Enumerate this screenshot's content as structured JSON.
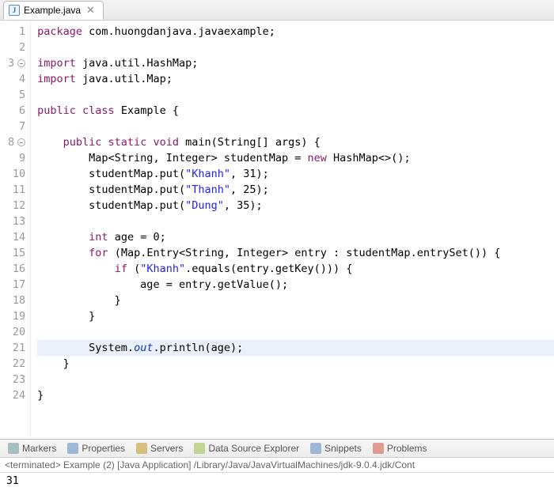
{
  "tab": {
    "filename": "Example.java"
  },
  "code": {
    "lines": [
      {
        "n": 1,
        "tokens": [
          [
            "kw",
            "package"
          ],
          [
            "",
            " com.huongdanjava.javaexample;"
          ]
        ]
      },
      {
        "n": 2,
        "tokens": []
      },
      {
        "n": 3,
        "fold": true,
        "tokens": [
          [
            "kw",
            "import"
          ],
          [
            "",
            " java.util.HashMap;"
          ]
        ]
      },
      {
        "n": 4,
        "tokens": [
          [
            "kw",
            "import"
          ],
          [
            "",
            " java.util.Map;"
          ]
        ]
      },
      {
        "n": 5,
        "tokens": []
      },
      {
        "n": 6,
        "tokens": [
          [
            "kw",
            "public class"
          ],
          [
            "",
            " Example {"
          ]
        ]
      },
      {
        "n": 7,
        "tokens": []
      },
      {
        "n": 8,
        "fold": true,
        "tokens": [
          [
            "",
            "    "
          ],
          [
            "kw",
            "public static void"
          ],
          [
            "",
            " main(String[] args) {"
          ]
        ]
      },
      {
        "n": 9,
        "tokens": [
          [
            "",
            "        Map<String, Integer> studentMap = "
          ],
          [
            "kw",
            "new"
          ],
          [
            "",
            " HashMap<>();"
          ]
        ]
      },
      {
        "n": 10,
        "tokens": [
          [
            "",
            "        studentMap.put("
          ],
          [
            "str",
            "\"Khanh\""
          ],
          [
            "",
            ", 31);"
          ]
        ]
      },
      {
        "n": 11,
        "tokens": [
          [
            "",
            "        studentMap.put("
          ],
          [
            "str",
            "\"Thanh\""
          ],
          [
            "",
            ", 25);"
          ]
        ]
      },
      {
        "n": 12,
        "tokens": [
          [
            "",
            "        studentMap.put("
          ],
          [
            "str",
            "\"Dung\""
          ],
          [
            "",
            ", 35);"
          ]
        ]
      },
      {
        "n": 13,
        "tokens": []
      },
      {
        "n": 14,
        "tokens": [
          [
            "",
            "        "
          ],
          [
            "kw",
            "int"
          ],
          [
            "",
            " age = 0;"
          ]
        ]
      },
      {
        "n": 15,
        "tokens": [
          [
            "",
            "        "
          ],
          [
            "kw",
            "for"
          ],
          [
            "",
            " (Map.Entry<String, Integer> entry : studentMap.entrySet()) {"
          ]
        ]
      },
      {
        "n": 16,
        "tokens": [
          [
            "",
            "            "
          ],
          [
            "kw",
            "if"
          ],
          [
            "",
            " ("
          ],
          [
            "str",
            "\"Khanh\""
          ],
          [
            "",
            ".equals(entry.getKey())) {"
          ]
        ]
      },
      {
        "n": 17,
        "tokens": [
          [
            "",
            "                age = entry.getValue();"
          ]
        ]
      },
      {
        "n": 18,
        "tokens": [
          [
            "",
            "            }"
          ]
        ]
      },
      {
        "n": 19,
        "tokens": [
          [
            "",
            "        }"
          ]
        ]
      },
      {
        "n": 20,
        "tokens": []
      },
      {
        "n": 21,
        "highlight": true,
        "tokens": [
          [
            "",
            "        System."
          ],
          [
            "field",
            "out"
          ],
          [
            "",
            ".println(age);"
          ]
        ]
      },
      {
        "n": 22,
        "tokens": [
          [
            "",
            "    }"
          ]
        ]
      },
      {
        "n": 23,
        "tokens": []
      },
      {
        "n": 24,
        "tokens": [
          [
            "",
            "}"
          ]
        ]
      }
    ]
  },
  "bottom_tabs": [
    {
      "id": "markers",
      "label": "Markers",
      "color": "#8aa"
    },
    {
      "id": "properties",
      "label": "Properties",
      "color": "#7a9ecb"
    },
    {
      "id": "servers",
      "label": "Servers",
      "color": "#c9a84d"
    },
    {
      "id": "data-source-explorer",
      "label": "Data Source Explorer",
      "color": "#b0c96a"
    },
    {
      "id": "snippets",
      "label": "Snippets",
      "color": "#7a9ecb"
    },
    {
      "id": "problems",
      "label": "Problems",
      "color": "#d4766a"
    }
  ],
  "console": {
    "status": "<terminated> Example (2) [Java Application] /Library/Java/JavaVirtualMachines/jdk-9.0.4.jdk/Cont",
    "output": "31"
  }
}
